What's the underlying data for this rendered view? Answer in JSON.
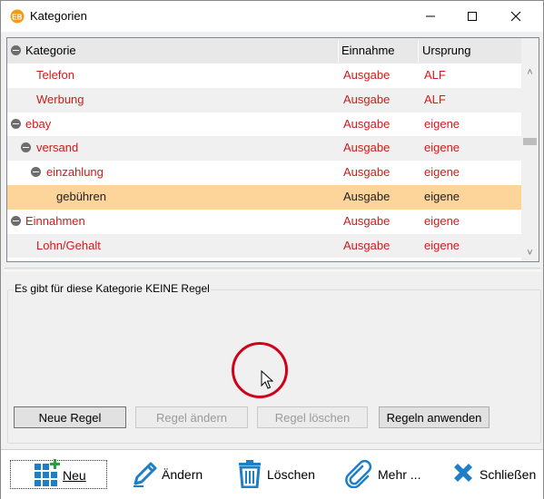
{
  "window": {
    "title": "Kategorien",
    "app_icon": "eb-logo-icon"
  },
  "columns": {
    "kategorie": "Kategorie",
    "einnahme": "Einnahme",
    "ursprung": "Ursprung"
  },
  "rows": [
    {
      "kategorie": "Telefon",
      "einnahme": "Ausgabe",
      "ursprung": "ALF"
    },
    {
      "kategorie": "Werbung",
      "einnahme": "Ausgabe",
      "ursprung": "ALF"
    },
    {
      "kategorie": "ebay",
      "einnahme": "Ausgabe",
      "ursprung": "eigene"
    },
    {
      "kategorie": "versand",
      "einnahme": "Ausgabe",
      "ursprung": "eigene"
    },
    {
      "kategorie": "einzahlung",
      "einnahme": "Ausgabe",
      "ursprung": "eigene"
    },
    {
      "kategorie": "gebühren",
      "einnahme": "Ausgabe",
      "ursprung": "eigene"
    },
    {
      "kategorie": "Einnahmen",
      "einnahme": "Ausgabe",
      "ursprung": "eigene"
    },
    {
      "kategorie": "Lohn/Gehalt",
      "einnahme": "Ausgabe",
      "ursprung": "eigene"
    }
  ],
  "rules": {
    "group_label": "Es gibt für diese Kategorie KEINE Regel",
    "new_rule": "Neue Regel",
    "edit_rule": "Regel ändern",
    "delete_rule": "Regel löschen",
    "apply_rules": "Regeln anwenden"
  },
  "footer": {
    "new": "Neu",
    "edit": "Ändern",
    "delete": "Löschen",
    "more": "Mehr ...",
    "close": "Schließen"
  },
  "colors": {
    "category_text": "#d11a1a",
    "selected_row": "#fdd49a",
    "annotation_circle": "#d0021b"
  }
}
